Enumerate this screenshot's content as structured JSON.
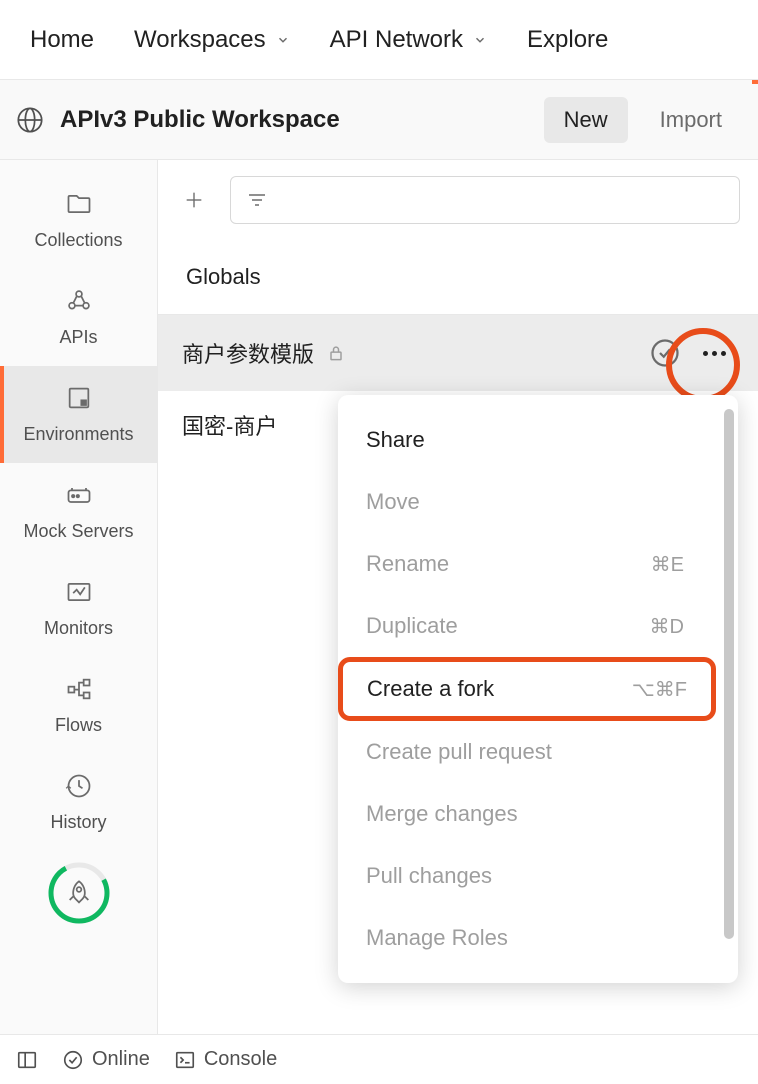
{
  "topNav": {
    "home": "Home",
    "workspaces": "Workspaces",
    "apiNetwork": "API Network",
    "explore": "Explore"
  },
  "workspace": {
    "title": "APIv3 Public Workspace",
    "newBtn": "New",
    "importBtn": "Import"
  },
  "sidebar": {
    "collections": "Collections",
    "apis": "APIs",
    "environments": "Environments",
    "mockServers": "Mock Servers",
    "monitors": "Monitors",
    "flows": "Flows",
    "history": "History"
  },
  "content": {
    "globalsLabel": "Globals",
    "env1": "商户参数模版",
    "env2": "国密-商户"
  },
  "menu": {
    "share": "Share",
    "move": "Move",
    "rename": "Rename",
    "renameShortcut": "⌘E",
    "duplicate": "Duplicate",
    "duplicateShortcut": "⌘D",
    "createFork": "Create a fork",
    "createForkShortcut": "⌥⌘F",
    "createPR": "Create pull request",
    "mergeChanges": "Merge changes",
    "pullChanges": "Pull changes",
    "manageRoles": "Manage Roles"
  },
  "footer": {
    "online": "Online",
    "console": "Console"
  }
}
